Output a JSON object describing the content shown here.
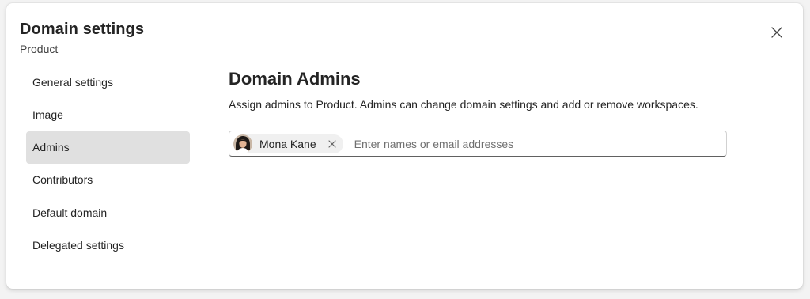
{
  "dialog": {
    "title": "Domain settings",
    "subtitle": "Product",
    "close_icon": "close-icon"
  },
  "nav": {
    "items": [
      {
        "label": "General settings",
        "selected": false
      },
      {
        "label": "Image",
        "selected": false
      },
      {
        "label": "Admins",
        "selected": true
      },
      {
        "label": "Contributors",
        "selected": false
      },
      {
        "label": "Default domain",
        "selected": false
      },
      {
        "label": "Delegated settings",
        "selected": false
      }
    ]
  },
  "main": {
    "title": "Domain Admins",
    "description": "Assign admins to Product. Admins can change domain settings and add or remove workspaces.",
    "picker": {
      "chips": [
        {
          "name": "Mona Kane",
          "remove_icon": "dismiss-icon"
        }
      ],
      "placeholder": "Enter names or email addresses"
    }
  },
  "colors": {
    "selected_nav_bg": "#e0e0e0",
    "text": "#242424",
    "chip_bg": "#f0f0f0"
  }
}
